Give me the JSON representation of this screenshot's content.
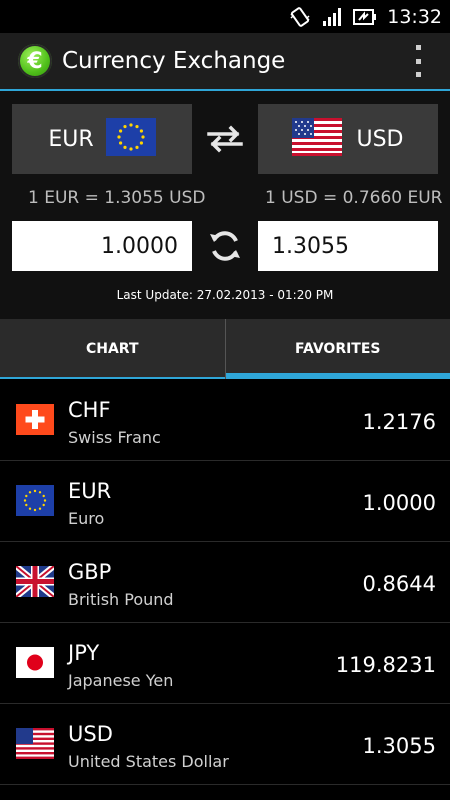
{
  "status_bar": {
    "time": "13:32",
    "icons": [
      "vibrate-icon",
      "signal-icon",
      "battery-icon"
    ]
  },
  "action_bar": {
    "title": "Currency Exchange",
    "logo_symbol": "€"
  },
  "converter": {
    "from_code": "EUR",
    "to_code": "USD",
    "from_rate": "1 EUR = 1.3055 USD",
    "to_rate": "1 USD = 0.7660 EUR",
    "from_amount": "1.0000",
    "to_amount": "1.3055",
    "last_update": "Last Update:  27.02.2013  -  01:20 PM"
  },
  "tabs": [
    {
      "label": "CHART"
    },
    {
      "label": "FAVORITES",
      "active": true
    }
  ],
  "favorites": [
    {
      "code": "CHF",
      "name": "Swiss Franc",
      "value": "1.2176"
    },
    {
      "code": "EUR",
      "name": "Euro",
      "value": "1.0000"
    },
    {
      "code": "GBP",
      "name": "British Pound",
      "value": "0.8644"
    },
    {
      "code": "JPY",
      "name": "Japanese Yen",
      "value": "119.8231"
    },
    {
      "code": "USD",
      "name": "United States Dollar",
      "value": "1.3055"
    }
  ],
  "colors": {
    "accent": "#2fa6d8",
    "background": "#000000",
    "bar": "#1e1e1e"
  }
}
